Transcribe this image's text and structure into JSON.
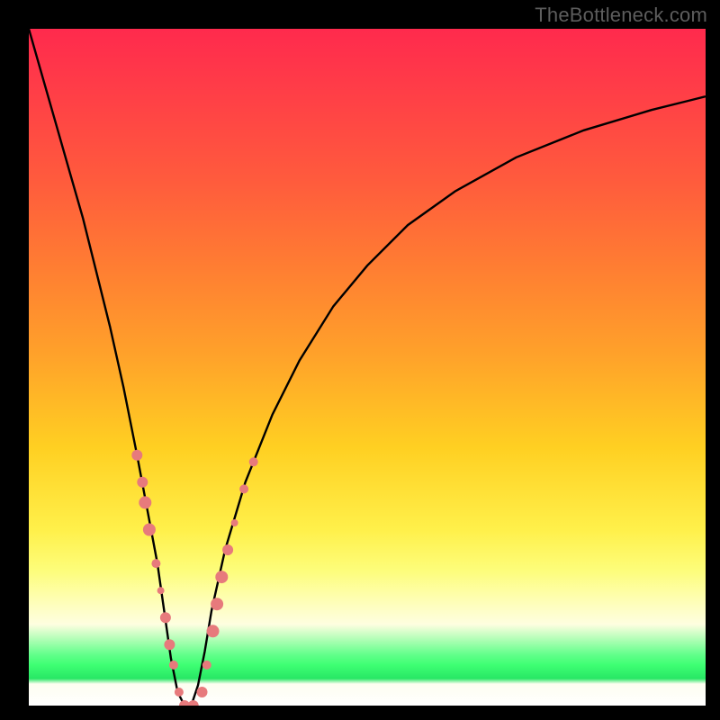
{
  "watermark": "TheBottleneck.com",
  "colors": {
    "frame": "#000000",
    "gradient_top": "#ff2a4d",
    "gradient_mid": "#ffd022",
    "gradient_low": "#fefec2",
    "gradient_green": "#3eff73",
    "curve": "#000000",
    "markers": "#e77a7c"
  },
  "chart_data": {
    "type": "line",
    "title": "",
    "xlabel": "",
    "ylabel": "",
    "xlim": [
      0,
      100
    ],
    "ylim": [
      0,
      100
    ],
    "series": [
      {
        "name": "bottleneck-curve",
        "x": [
          0,
          2,
          4,
          6,
          8,
          10,
          12,
          14,
          16,
          17.5,
          19,
          20,
          21,
          22,
          23,
          24,
          25,
          26,
          27,
          29,
          32,
          36,
          40,
          45,
          50,
          56,
          63,
          72,
          82,
          92,
          100
        ],
        "y": [
          100,
          93,
          86,
          79,
          72,
          64,
          56,
          47,
          37,
          29,
          21,
          14,
          7,
          2,
          0,
          0,
          3,
          8,
          14,
          23,
          33,
          43,
          51,
          59,
          65,
          71,
          76,
          81,
          85,
          88,
          90
        ]
      }
    ],
    "markers": [
      {
        "x": 16.0,
        "y": 37,
        "r": 6
      },
      {
        "x": 16.8,
        "y": 33,
        "r": 6
      },
      {
        "x": 17.2,
        "y": 30,
        "r": 7
      },
      {
        "x": 17.8,
        "y": 26,
        "r": 7
      },
      {
        "x": 18.8,
        "y": 21,
        "r": 5
      },
      {
        "x": 19.5,
        "y": 17,
        "r": 4
      },
      {
        "x": 20.2,
        "y": 13,
        "r": 6
      },
      {
        "x": 20.8,
        "y": 9,
        "r": 6
      },
      {
        "x": 21.4,
        "y": 6,
        "r": 5
      },
      {
        "x": 22.2,
        "y": 2,
        "r": 5
      },
      {
        "x": 23.0,
        "y": 0,
        "r": 6
      },
      {
        "x": 24.3,
        "y": 0,
        "r": 6
      },
      {
        "x": 25.6,
        "y": 2,
        "r": 6
      },
      {
        "x": 26.3,
        "y": 6,
        "r": 5
      },
      {
        "x": 27.2,
        "y": 11,
        "r": 7
      },
      {
        "x": 27.8,
        "y": 15,
        "r": 7
      },
      {
        "x": 28.5,
        "y": 19,
        "r": 7
      },
      {
        "x": 29.4,
        "y": 23,
        "r": 6
      },
      {
        "x": 30.4,
        "y": 27,
        "r": 4
      },
      {
        "x": 31.8,
        "y": 32,
        "r": 5
      },
      {
        "x": 33.2,
        "y": 36,
        "r": 5
      }
    ]
  }
}
